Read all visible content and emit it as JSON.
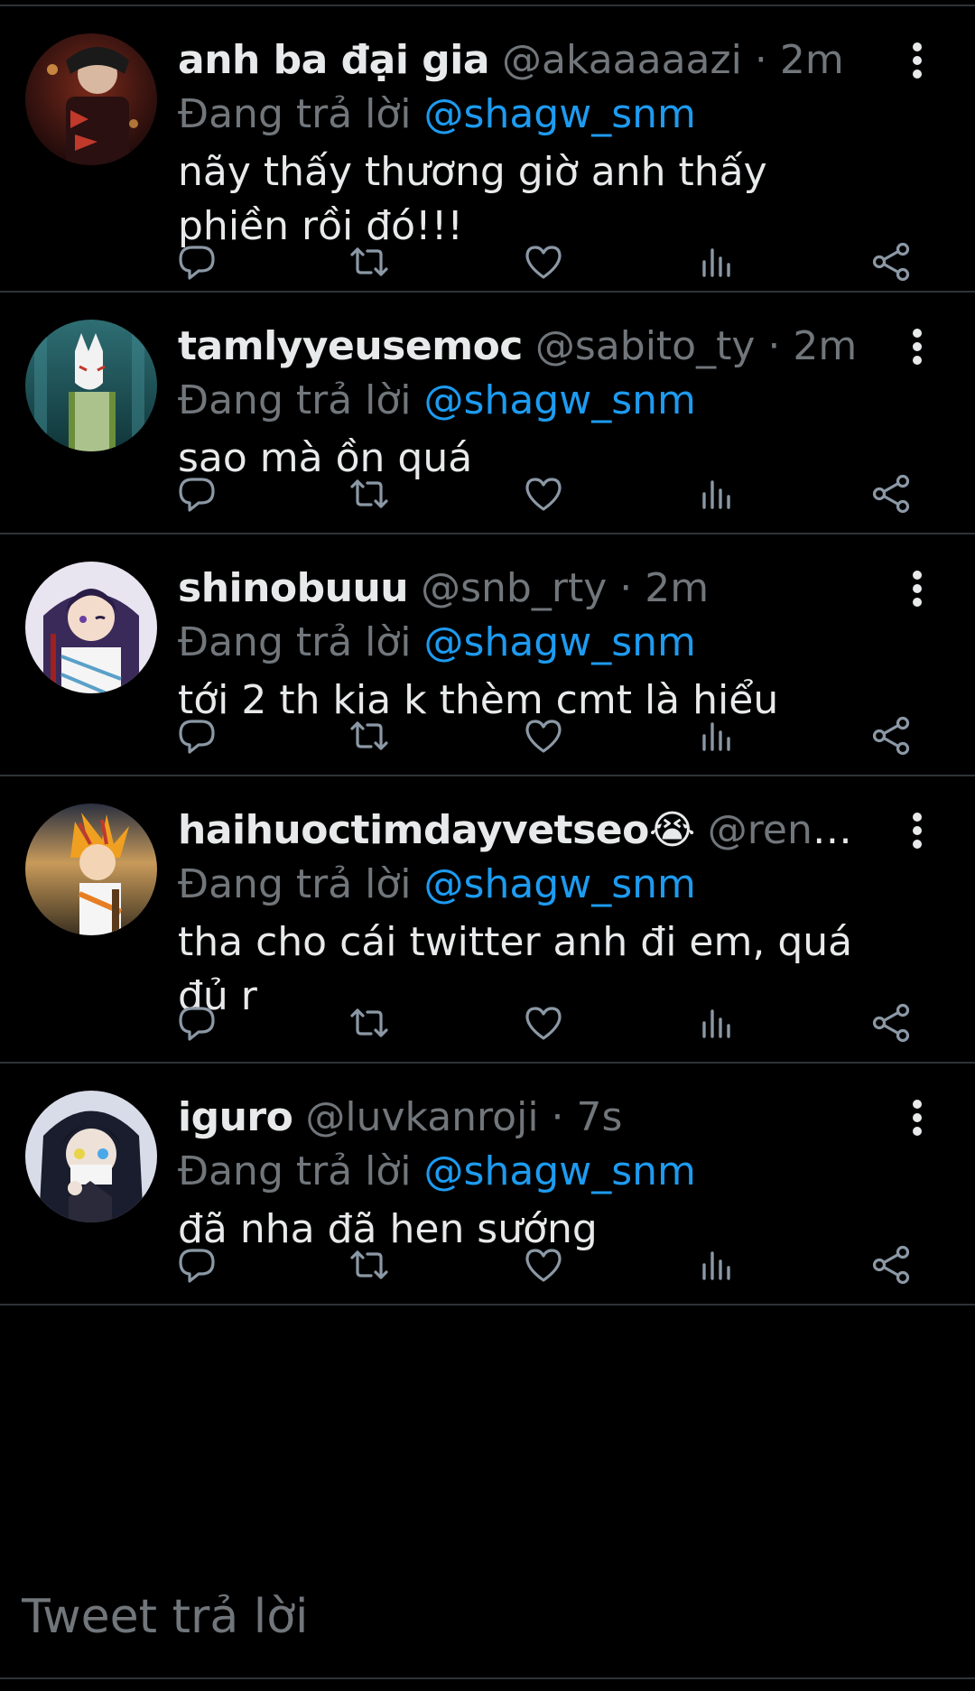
{
  "colors": {
    "background": "#000000",
    "text": "#e7e9ea",
    "secondary": "#71767b",
    "link": "#1d9bf0",
    "divider": "#2f3336"
  },
  "tweets": [
    {
      "name": "anh ba đại gia",
      "handle": "@akaaaaazi",
      "separator": "·",
      "time": "2m",
      "reply_prefix": "Đang trả lời",
      "reply_to": "@shagw_snm",
      "text": "nãy thấy thương giờ anh thấy phiền rồi đó!!!",
      "avatar_icon": "avatar-dark-red-character"
    },
    {
      "name": "tamlyyeusemoc",
      "handle": "@sabito_ty",
      "separator": "·",
      "time": "2m",
      "reply_prefix": "Đang trả lời",
      "reply_to": "@shagw_snm",
      "text": "sao mà ồn quá",
      "avatar_icon": "avatar-fox-mask-character"
    },
    {
      "name": "shinobuuu",
      "handle": "@snb_rty",
      "separator": "·",
      "time": "2m",
      "reply_prefix": "Đang trả lời",
      "reply_to": "@shagw_snm",
      "text": "tới 2 th kia k thèm cmt là hiểu",
      "avatar_icon": "avatar-purple-hair-character"
    },
    {
      "name": "haihuoctimdayvetseo😭",
      "handle": "@rengo...",
      "separator": "",
      "time": "",
      "reply_prefix": "Đang trả lời",
      "reply_to": "@shagw_snm",
      "text": "tha cho cái twitter anh đi em, quá đủ r",
      "avatar_icon": "avatar-flame-hair-character"
    },
    {
      "name": "iguro",
      "handle": "@luvkanroji",
      "separator": "·",
      "time": "7s",
      "reply_prefix": "Đang trả lời",
      "reply_to": "@shagw_snm",
      "text": "đã nha đã hen sướng",
      "avatar_icon": "avatar-dark-hair-character"
    }
  ],
  "action_icons": [
    "reply-icon",
    "retweet-icon",
    "like-icon",
    "analytics-icon",
    "share-icon"
  ],
  "reply_box": {
    "placeholder": "Tweet trả lời"
  }
}
